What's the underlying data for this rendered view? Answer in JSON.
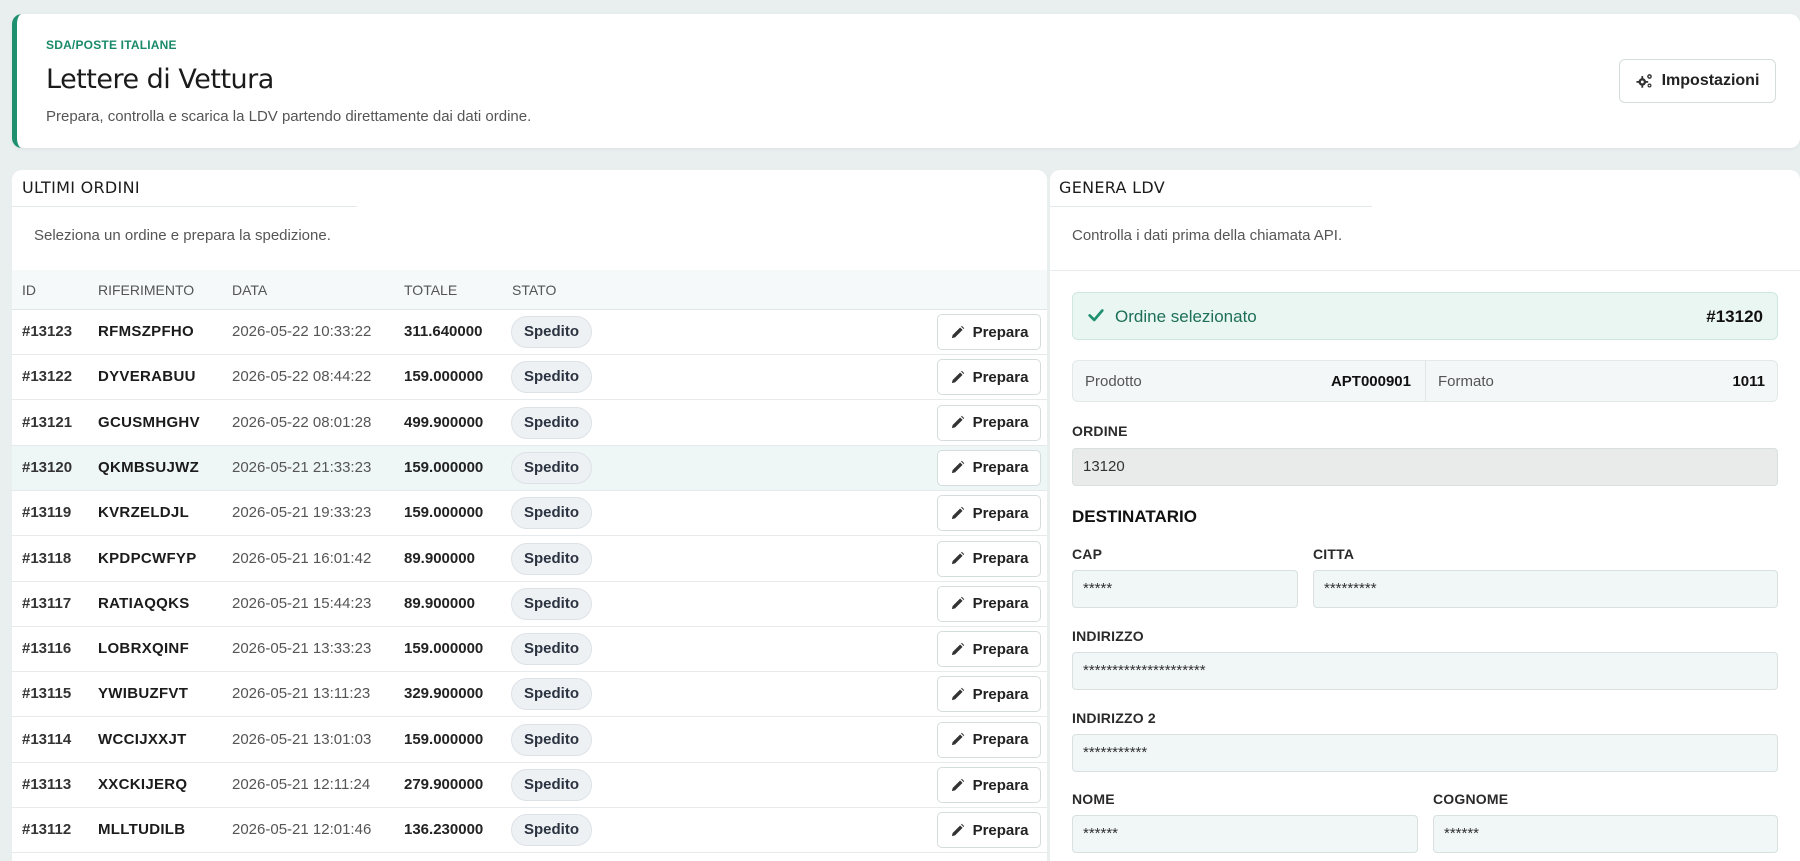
{
  "header": {
    "eyebrow": "SDA/POSTE ITALIANE",
    "title": "Lettere di Vettura",
    "subtitle": "Prepara, controlla e scarica la LDV partendo direttamente dai dati ordine.",
    "settings_label": "Impostazioni"
  },
  "orders": {
    "title": "ULTIMI ORDINI",
    "description": "Seleziona un ordine e prepara la spedizione.",
    "columns": {
      "id": "ID",
      "ref": "RIFERIMENTO",
      "date": "DATA",
      "total": "TOTALE",
      "status": "STATO"
    },
    "action_label": "Prepara",
    "rows": [
      {
        "id": "#13123",
        "ref": "RFMSZPFHO",
        "date": "2026-05-22 10:33:22",
        "total": "311.640000",
        "status": "Spedito"
      },
      {
        "id": "#13122",
        "ref": "DYVERABUU",
        "date": "2026-05-22 08:44:22",
        "total": "159.000000",
        "status": "Spedito"
      },
      {
        "id": "#13121",
        "ref": "GCUSMHGHV",
        "date": "2026-05-22 08:01:28",
        "total": "499.900000",
        "status": "Spedito"
      },
      {
        "id": "#13120",
        "ref": "QKMBSUJWZ",
        "date": "2026-05-21 21:33:23",
        "total": "159.000000",
        "status": "Spedito",
        "selected": true
      },
      {
        "id": "#13119",
        "ref": "KVRZELDJL",
        "date": "2026-05-21 19:33:23",
        "total": "159.000000",
        "status": "Spedito"
      },
      {
        "id": "#13118",
        "ref": "KPDPCWFYP",
        "date": "2026-05-21 16:01:42",
        "total": "89.900000",
        "status": "Spedito"
      },
      {
        "id": "#13117",
        "ref": "RATIAQQKS",
        "date": "2026-05-21 15:44:23",
        "total": "89.900000",
        "status": "Spedito"
      },
      {
        "id": "#13116",
        "ref": "LOBRXQINF",
        "date": "2026-05-21 13:33:23",
        "total": "159.000000",
        "status": "Spedito"
      },
      {
        "id": "#13115",
        "ref": "YWIBUZFVT",
        "date": "2026-05-21 13:11:23",
        "total": "329.900000",
        "status": "Spedito"
      },
      {
        "id": "#13114",
        "ref": "WCCIJXXJT",
        "date": "2026-05-21 13:01:03",
        "total": "159.000000",
        "status": "Spedito"
      },
      {
        "id": "#13113",
        "ref": "XXCKIJERQ",
        "date": "2026-05-21 12:11:24",
        "total": "279.900000",
        "status": "Spedito"
      },
      {
        "id": "#13112",
        "ref": "MLLTUDILB",
        "date": "2026-05-21 12:01:46",
        "total": "136.230000",
        "status": "Spedito"
      }
    ]
  },
  "form": {
    "title": "GENERA LDV",
    "description": "Controlla i dati prima della chiamata API.",
    "selected_label": "Ordine selezionato",
    "selected_number": "#13120",
    "product_label": "Prodotto",
    "product_value": "APT000901",
    "format_label": "Formato",
    "format_value": "1011",
    "order_label": "ORDINE",
    "order_value": "13120",
    "recipient_title": "DESTINATARIO",
    "cap_label": "CAP",
    "cap_value": "*****",
    "city_label": "CITTA",
    "city_value": "*********",
    "address_label": "INDIRIZZO",
    "address_value": "*********************",
    "address2_label": "INDIRIZZO 2",
    "address2_value": "***********",
    "name_label": "NOME",
    "name_value": "******",
    "surname_label": "COGNOME",
    "surname_value": "******"
  },
  "colors": {
    "accent": "#1e8f6f",
    "badge_bg": "#eef1f4",
    "selected_row": "#eef7f5"
  }
}
